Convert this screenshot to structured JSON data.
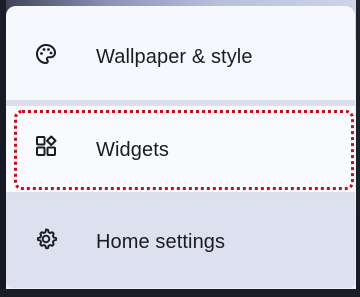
{
  "menu": {
    "items": [
      {
        "label": "Wallpaper & style",
        "icon": "palette-icon"
      },
      {
        "label": "Widgets",
        "icon": "widgets-icon"
      },
      {
        "label": "Home settings",
        "icon": "gear-icon"
      }
    ]
  },
  "colors": {
    "highlight": "#c0101a",
    "text": "#1b1c20"
  }
}
